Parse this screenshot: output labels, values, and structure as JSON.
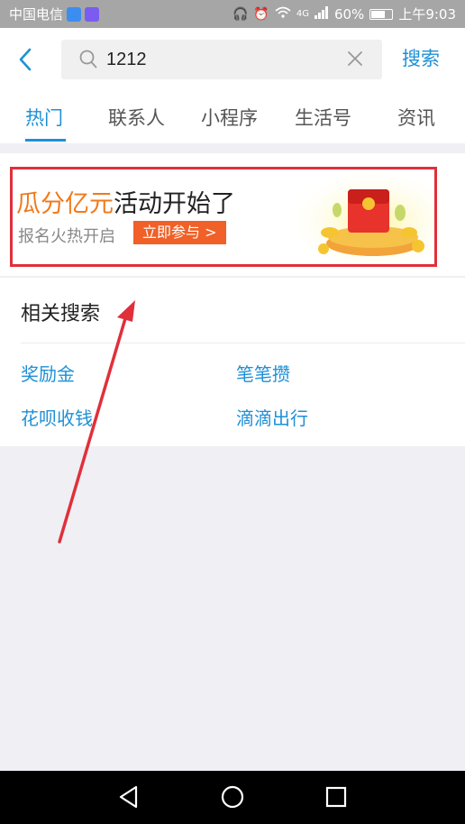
{
  "status_bar": {
    "carrier": "中国电信",
    "battery": "60%",
    "time": "上午9:03",
    "network": "4G"
  },
  "search": {
    "query": "1212",
    "button_label": "搜索"
  },
  "tabs": [
    {
      "label": "热门"
    },
    {
      "label": "联系人"
    },
    {
      "label": "小程序"
    },
    {
      "label": "生活号"
    },
    {
      "label": "资讯"
    }
  ],
  "banner": {
    "title_highlight": "瓜分亿元",
    "title_rest": "活动开始了",
    "subtitle": "报名火热开启",
    "cta": "立即参与 >"
  },
  "related": {
    "title": "相关搜索",
    "items": [
      {
        "label": "奖励金"
      },
      {
        "label": "笔笔攒"
      },
      {
        "label": "花呗收钱"
      },
      {
        "label": "滴滴出行"
      }
    ]
  },
  "colors": {
    "accent": "#1e90d6",
    "highlight": "#f07a1c",
    "cta": "#f06027",
    "annotation": "#e0303a"
  }
}
